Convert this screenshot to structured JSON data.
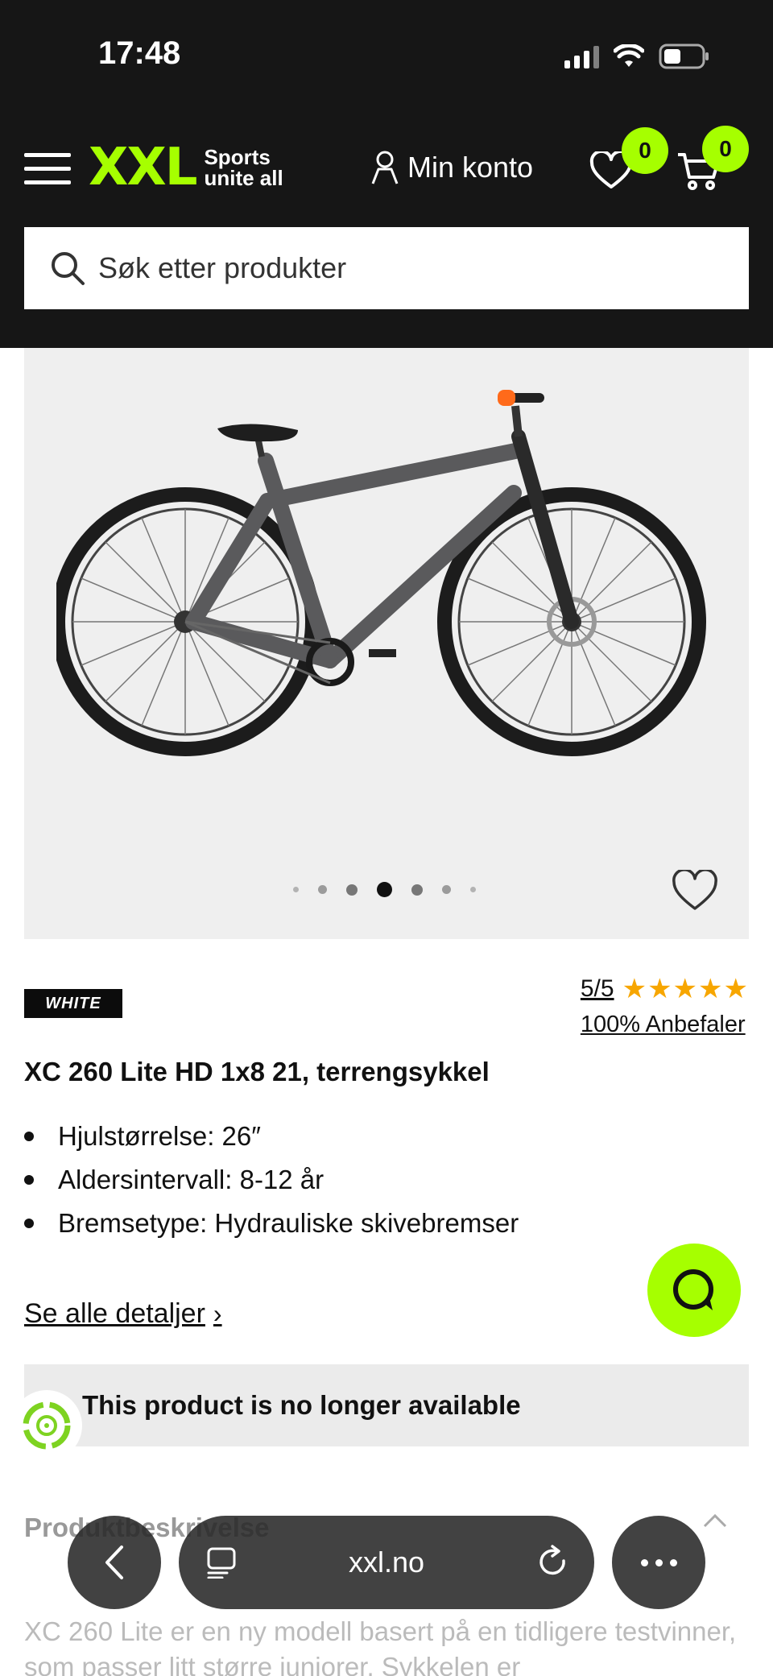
{
  "status_bar": {
    "time": "17:48",
    "icons": [
      "signal-icon",
      "wifi-icon",
      "battery-icon"
    ]
  },
  "header": {
    "logo_main": "XXL",
    "logo_tagline_1": "Sports",
    "logo_tagline_2": "unite all",
    "account_label": "Min konto",
    "wishlist_count": "0",
    "cart_count": "0",
    "search_placeholder": "Søk etter produkter",
    "colors": {
      "background": "#161616",
      "accent": "#a6ff00"
    }
  },
  "gallery": {
    "total_images": 7,
    "active_index": 3
  },
  "product": {
    "brand": "WHITE",
    "rating": "5/5",
    "stars": "★★★★★",
    "recommend": "100% Anbefaler",
    "title": "XC 260 Lite HD 1x8 21, terrengsykkel",
    "specs": [
      "Hjulstørrelse: 26″",
      "Aldersintervall: 8-12 år",
      "Bremsetype: Hydrauliske skivebremser"
    ],
    "details_link": "Se alle detaljer",
    "unavailable": "This product is no longer available"
  },
  "description": {
    "heading": "Produktbeskrivelse",
    "text": "XC 260 Lite er en ny modell basert på en tidligere testvinner, som passer litt større juniorer. Sykkelen er"
  },
  "browser": {
    "url": "xxl.no"
  }
}
